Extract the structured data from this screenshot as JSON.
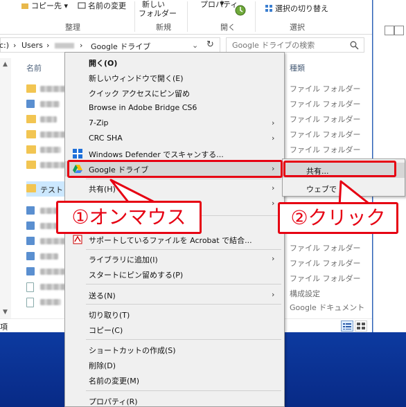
{
  "ribbon": {
    "copy_dest": "コピー先",
    "rename": "名前の変更",
    "new_folder_line1": "新しい",
    "new_folder_line2": "フォルダー",
    "properties": "プロパティ",
    "invert_selection": "選択の切り替え",
    "groups": [
      "整理",
      "新規",
      "開く",
      "選択"
    ]
  },
  "address": {
    "drive": "c:)",
    "users": "Users",
    "current": "Google ドライブ",
    "search_placeholder": "Google ドライブの検索"
  },
  "columns": {
    "name": "名前",
    "type": "種類"
  },
  "files": [
    {
      "name": "",
      "icon": "folder"
    },
    {
      "name": "",
      "icon": "contact"
    },
    {
      "name": "",
      "icon": "folder"
    },
    {
      "name": "",
      "icon": "folder"
    },
    {
      "name": "",
      "icon": "folder"
    },
    {
      "name": "",
      "icon": "folder"
    },
    {
      "name": "テスト",
      "icon": "folder",
      "selected": true
    },
    {
      "name": "",
      "icon": "contact"
    },
    {
      "name": "",
      "icon": "contact"
    },
    {
      "name": "",
      "icon": "contact"
    },
    {
      "name": "",
      "icon": "contact"
    },
    {
      "name": "",
      "icon": "contact"
    },
    {
      "name": "",
      "icon": "doc"
    },
    {
      "name": "",
      "icon": "doc"
    }
  ],
  "types": [
    "ファイル フォルダー",
    "ファイル フォルダー",
    "ファイル フォルダー",
    "ファイル フォルダー",
    "ファイル フォルダー",
    "ファイル フォルダー",
    "ファイル フォルダー",
    "ファイル フォルダー",
    "構成設定",
    "Google ドキュメント"
  ],
  "status": {
    "left": "項"
  },
  "context_menu": {
    "items": [
      {
        "label": "開く(O)",
        "bold": true
      },
      {
        "label": "新しいウィンドウで開く(E)"
      },
      {
        "label": "クイック アクセスにピン留め"
      },
      {
        "label": "Browse in Adobe Bridge CS6"
      },
      {
        "label": "7-Zip",
        "submenu": true
      },
      {
        "label": "CRC SHA",
        "submenu": true
      },
      {
        "label": "Windows Defender でスキャンする...",
        "icon": "shield-icon"
      },
      {
        "label": "Google ドライブ",
        "submenu": true,
        "icon": "google-drive-icon"
      },
      {
        "label": "共有(H)",
        "submenu": true
      },
      {
        "label": "",
        "submenu": true
      },
      {
        "label": "サポートしているファイルを Acrobat で結合...",
        "icon": "acrobat-icon"
      },
      {
        "label": "ライブラリに追加(I)",
        "submenu": true
      },
      {
        "label": "スタートにピン留めする(P)"
      },
      {
        "label": "送る(N)",
        "submenu": true
      },
      {
        "label": "切り取り(T)"
      },
      {
        "label": "コピー(C)"
      },
      {
        "label": "ショートカットの作成(S)"
      },
      {
        "label": "削除(D)"
      },
      {
        "label": "名前の変更(M)"
      },
      {
        "label": "プロパティ(R)"
      }
    ]
  },
  "submenu": {
    "share": "共有...",
    "web": "ウェブで"
  },
  "annotations": {
    "callout1": "①オンマウス",
    "callout2": "②クリック",
    "color": "#e60012"
  }
}
